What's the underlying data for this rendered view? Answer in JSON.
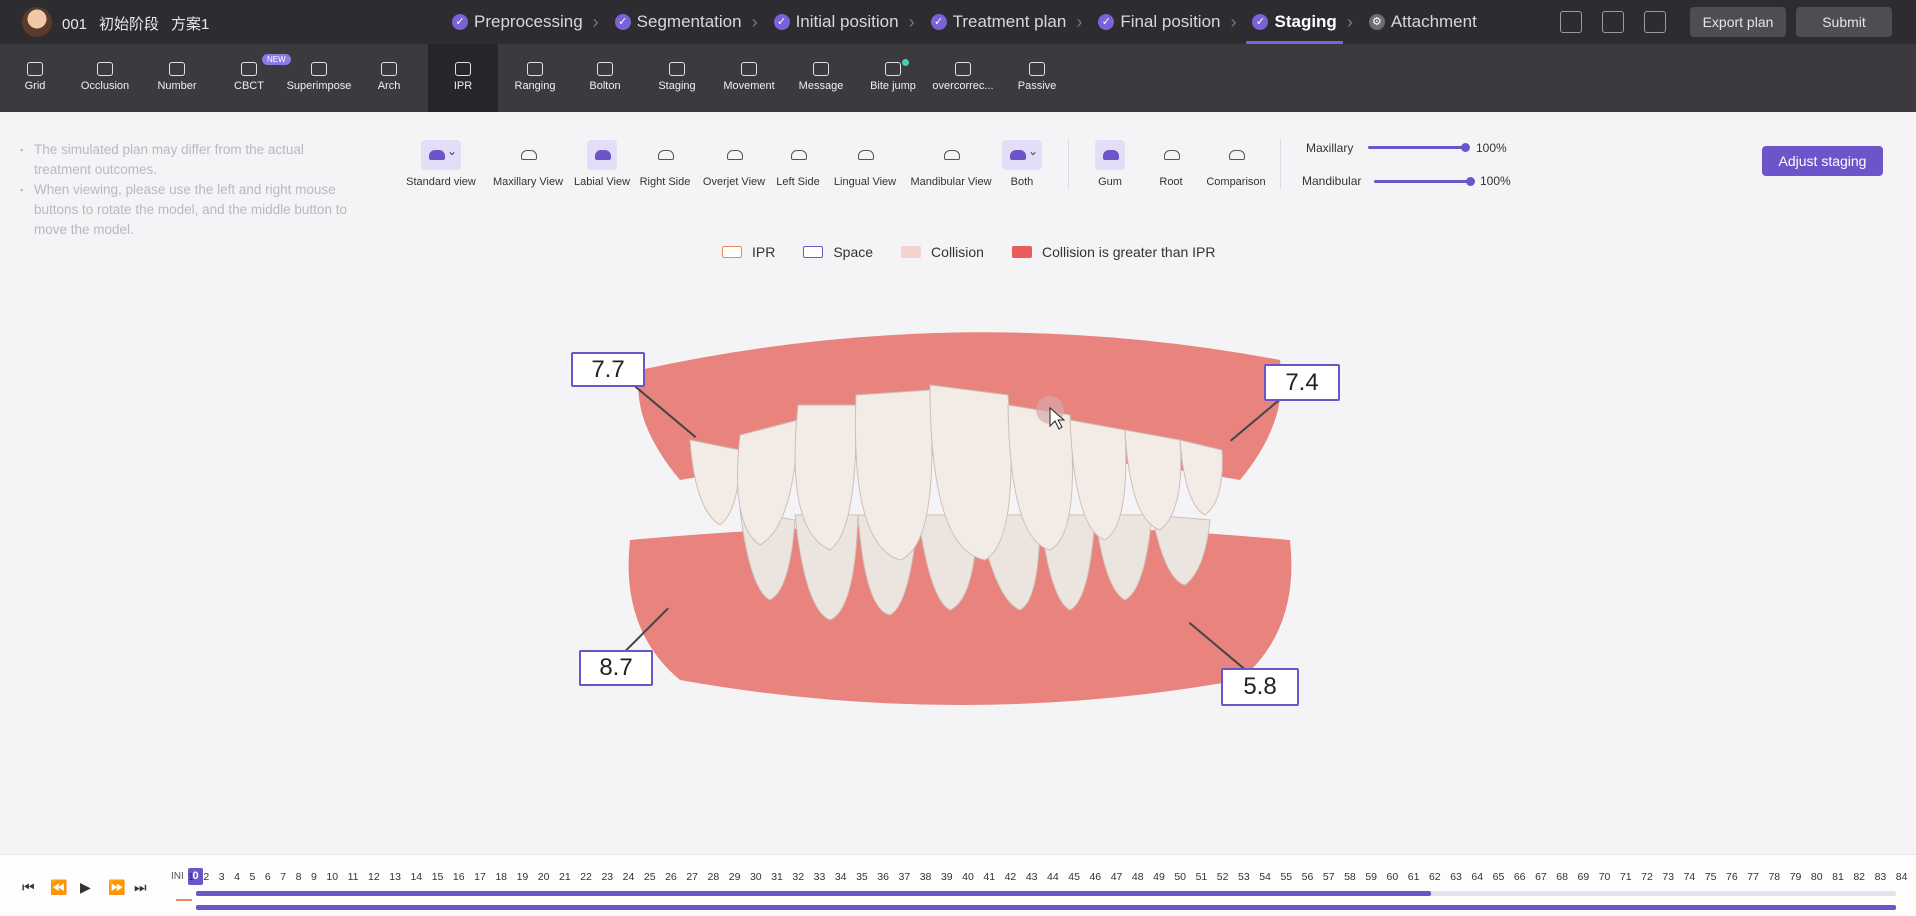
{
  "header": {
    "case_id": "001",
    "stage": "初始阶段",
    "plan": "方案1",
    "steps": [
      {
        "label": "Preprocessing",
        "done": true
      },
      {
        "label": "Segmentation",
        "done": true
      },
      {
        "label": "Initial position",
        "done": true
      },
      {
        "label": "Treatment plan",
        "done": true
      },
      {
        "label": "Final position",
        "done": true
      },
      {
        "label": "Staging",
        "done": true,
        "active": true
      },
      {
        "label": "Attachment",
        "done": false
      }
    ],
    "export_label": "Export plan",
    "submit_label": "Submit"
  },
  "toolbar": {
    "tools": [
      {
        "label": "Grid",
        "icon": "grid-icon"
      },
      {
        "label": "Occlusion",
        "icon": "occlusion-icon"
      },
      {
        "label": "Number",
        "icon": "tooth-number-icon"
      },
      {
        "label": "CBCT",
        "icon": "cbct-icon"
      },
      {
        "label": "Superimpose",
        "icon": "layers-icon"
      },
      {
        "label": "Arch",
        "icon": "arch-icon"
      },
      {
        "label": "IPR",
        "icon": "ipr-icon"
      },
      {
        "label": "Ranging",
        "icon": "ranging-icon"
      },
      {
        "label": "Bolton",
        "icon": "bolton-icon"
      },
      {
        "label": "Staging",
        "icon": "staging-icon"
      },
      {
        "label": "Movement",
        "icon": "movement-icon"
      },
      {
        "label": "Message",
        "icon": "message-icon"
      },
      {
        "label": "Bite jump",
        "icon": "bite-jump-icon"
      },
      {
        "label": "overcorrec...",
        "icon": "overcorrection-icon"
      },
      {
        "label": "Passive",
        "icon": "passive-icon"
      }
    ],
    "new_badge": "NEW"
  },
  "notes": [
    "The simulated plan may differ from the actual treatment outcomes.",
    "When viewing, please use the left and right mouse buttons to rotate the model, and the middle button to move the model."
  ],
  "views": [
    {
      "label": "Standard view"
    },
    {
      "label": "Maxillary View"
    },
    {
      "label": "Labial View"
    },
    {
      "label": "Right Side"
    },
    {
      "label": "Overjet View"
    },
    {
      "label": "Left Side"
    },
    {
      "label": "Lingual View"
    },
    {
      "label": "Mandibular View"
    },
    {
      "label": "Both"
    },
    {
      "label": "Gum"
    },
    {
      "label": "Root"
    },
    {
      "label": "Comparison"
    }
  ],
  "opacity": {
    "maxillary_label": "Maxillary",
    "maxillary_value": "100%",
    "mandibular_label": "Mandibular",
    "mandibular_value": "100%"
  },
  "adjust_label": "Adjust staging",
  "legend": [
    {
      "label": "IPR",
      "fill": "#ffffff",
      "stroke": "#f08a5d"
    },
    {
      "label": "Space",
      "fill": "#ffffff",
      "stroke": "#6b55c8"
    },
    {
      "label": "Collision",
      "fill": "#f2d3cf",
      "stroke": "#f2d3cf"
    },
    {
      "label": "Collision is greater than IPR",
      "fill": "#e85d5a",
      "stroke": "#e85d5a"
    }
  ],
  "measurements": {
    "upper_right": "7.7",
    "upper_left": "7.4",
    "lower_right": "8.7",
    "lower_left": "5.8"
  },
  "timeline": {
    "ini_label": "INI",
    "current": "0",
    "ticks": [
      "1",
      "2",
      "3",
      "4",
      "5",
      "6",
      "7",
      "8",
      "9",
      "10",
      "11",
      "12",
      "13",
      "14",
      "15",
      "16",
      "17",
      "18",
      "19",
      "20",
      "21",
      "22",
      "23",
      "24",
      "25",
      "26",
      "27",
      "28",
      "29",
      "30",
      "31",
      "32",
      "33",
      "34",
      "35",
      "36",
      "37",
      "38",
      "39",
      "40",
      "41",
      "42",
      "43",
      "44",
      "45",
      "46",
      "47",
      "48",
      "49",
      "50",
      "51",
      "52",
      "53",
      "54",
      "55",
      "56",
      "57",
      "58",
      "59",
      "60",
      "61",
      "62",
      "63",
      "64",
      "65",
      "66",
      "67",
      "68",
      "69",
      "70",
      "71",
      "72",
      "73",
      "74",
      "75",
      "76",
      "77",
      "78",
      "79",
      "80",
      "81",
      "82",
      "83",
      "84"
    ],
    "upper_progress": 61,
    "upper_total": 84,
    "lower_progress": 84,
    "lower_total": 84
  },
  "colors": {
    "accent": "#6b55c8",
    "gum": "#e8837d",
    "tooth": "#efe7e1"
  }
}
